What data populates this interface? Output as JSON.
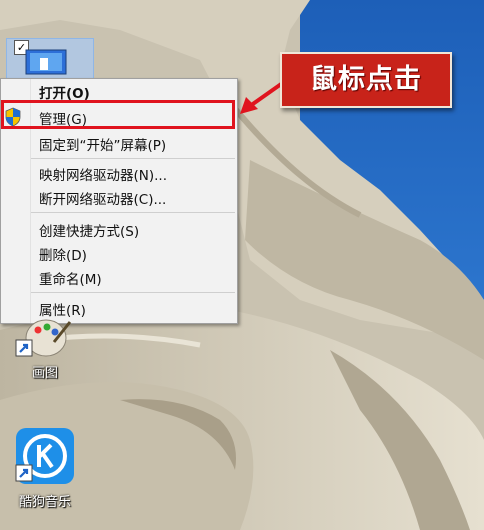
{
  "desktop": {
    "shortcuts": [
      {
        "label": "画图",
        "icon": "paint-icon"
      },
      {
        "label": "酷狗音乐",
        "icon": "kugou-icon"
      }
    ],
    "selected_icon": {
      "icon": "computer-icon",
      "checked": true
    }
  },
  "context_menu": {
    "items": [
      {
        "label": "打开(O)",
        "bold": true
      },
      {
        "label": "管理(G)",
        "icon": "uac-shield-icon",
        "highlighted": true
      },
      {
        "label": "固定到“开始”屏幕(P)"
      },
      {
        "label": "映射网络驱动器(N)..."
      },
      {
        "label": "断开网络驱动器(C)..."
      },
      {
        "label": "创建快捷方式(S)"
      },
      {
        "label": "删除(D)"
      },
      {
        "label": "重命名(M)"
      },
      {
        "label": "属性(R)"
      }
    ]
  },
  "annotation": {
    "callout_text": "鼠标点击",
    "highlight_color": "#e0141e",
    "callout_color": "#c8231a"
  }
}
